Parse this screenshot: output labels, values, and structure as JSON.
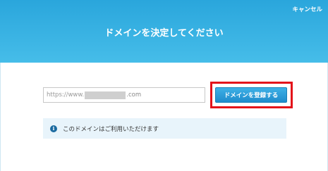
{
  "header": {
    "cancel_label": "キャンセル",
    "title": "ドメインを決定してください"
  },
  "domain_input": {
    "prefix": "https://www.",
    "suffix": ".com"
  },
  "register_button": {
    "label": "ドメインを登録する"
  },
  "info": {
    "icon": "info-icon",
    "message": "このドメインはご利用いただけます"
  },
  "colors": {
    "header_gradient_top": "#2aa6dc",
    "header_gradient_bottom": "#46bde9",
    "button_blue": "#1f8ccc",
    "highlight_red": "#e3121a",
    "info_bg": "#e8f4fb"
  }
}
